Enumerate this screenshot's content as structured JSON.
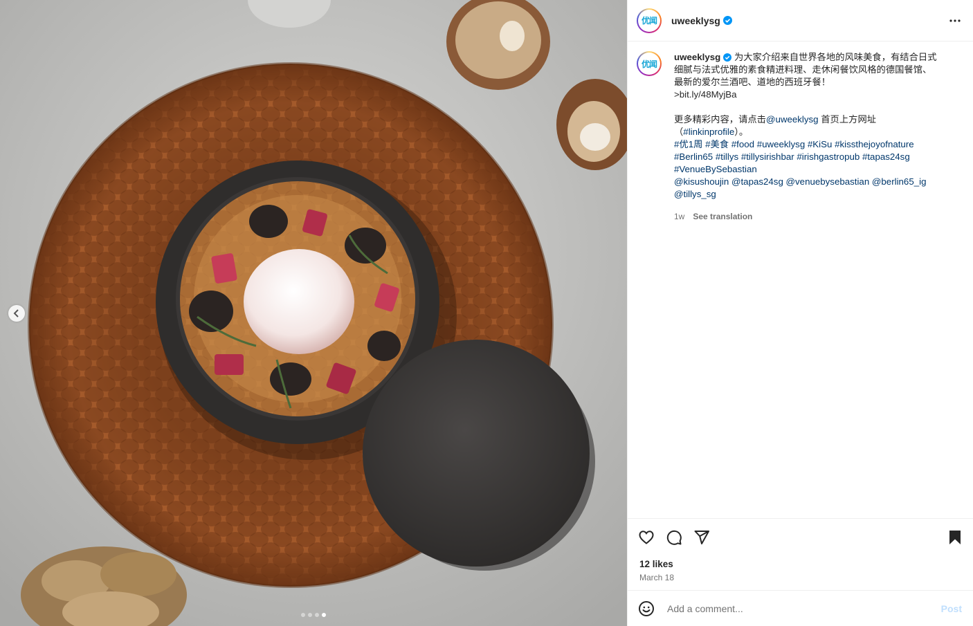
{
  "post": {
    "username": "uweeklysg",
    "avatar_text": "优闻",
    "caption_lines": [
      "为大家介绍来自世界各地的风味美食，有结合日式",
      "细腻与法式优雅的素食精进料理、走休闲餐饮风格的德国餐馆、",
      "最新的爱尔兰酒吧、道地的西班牙餐！"
    ],
    "link": ">bit.ly/48MyjBa",
    "more_prefix": "更多精彩内容，请点击",
    "more_mention": "@uweeklysg",
    "more_suffix": " 首页上方网址",
    "linkinprofile_open": "（",
    "linkinprofile_tag": "#linkinprofile",
    "linkinprofile_close": "）。",
    "hashtags_line1": "#优1周 #美食 #food #uweeklysg #KiSu #kissthejoyofnature",
    "hashtags_line2": "#Berlin65 #tillys #tillysirishbar #irishgastropub #tapas24sg",
    "hashtags_line3": "#VenueBySebastian",
    "mentions_line1": "@kisushoujin @tapas24sg @venuebysebastian @berlin65_ig",
    "mentions_line2": "@tillys_sg",
    "time_ago": "1w",
    "see_translation": "See translation",
    "likes": "12 likes",
    "date": "March 18"
  },
  "comment": {
    "placeholder": "Add a comment...",
    "post_label": "Post"
  },
  "carousel": {
    "total": 4,
    "active_index": 3
  },
  "colors": {
    "link": "#00376b",
    "muted": "#737373",
    "verified": "#0095f6"
  }
}
